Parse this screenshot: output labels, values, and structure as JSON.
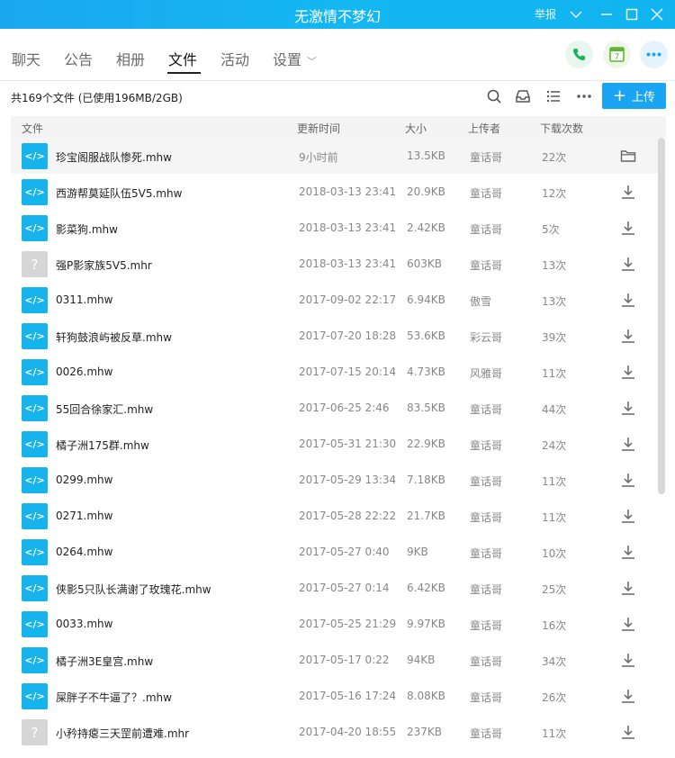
{
  "window": {
    "title": "无激情不梦幻",
    "report_label": "举报"
  },
  "tabs": [
    {
      "label": "聊天"
    },
    {
      "label": "公告"
    },
    {
      "label": "相册"
    },
    {
      "label": "文件",
      "active": true
    },
    {
      "label": "活动"
    },
    {
      "label": "设置"
    }
  ],
  "header_buttons": {
    "calendar_day": "7"
  },
  "toolbar": {
    "summary": "共169个文件 (已使用196MB/2GB)",
    "upload_label": "上传"
  },
  "columns": {
    "file": "文件",
    "updated": "更新时间",
    "size": "大小",
    "uploader": "上传者",
    "downloads": "下载次数"
  },
  "colors": {
    "accent": "#1aa5f2",
    "code_icon": "#16b3ed",
    "unknown_icon": "#d6d6d6"
  },
  "files": [
    {
      "name": "珍宝阁服战队惨死.mhw",
      "time": "9小时前",
      "size": "13.5KB",
      "uploader": "童话哥",
      "downloads": "22次",
      "icon": "code-file-icon",
      "action": "folder-icon"
    },
    {
      "name": "西游帮莫延队伍5V5.mhw",
      "time": "2018-03-13 23:41",
      "size": "20.9KB",
      "uploader": "童话哥",
      "downloads": "12次",
      "icon": "code-file-icon",
      "action": "download-icon"
    },
    {
      "name": "影菜狗.mhw",
      "time": "2018-03-13 23:41",
      "size": "2.42KB",
      "uploader": "童话哥",
      "downloads": "5次",
      "icon": "code-file-icon",
      "action": "download-icon"
    },
    {
      "name": "强P影家族5V5.mhr",
      "time": "2018-03-13 23:41",
      "size": "603KB",
      "uploader": "童话哥",
      "downloads": "13次",
      "icon": "unknown-file-icon",
      "action": "download-icon"
    },
    {
      "name": "0311.mhw",
      "time": "2017-09-02 22:17",
      "size": "6.94KB",
      "uploader": "傲雪",
      "downloads": "13次",
      "icon": "code-file-icon",
      "action": "download-icon"
    },
    {
      "name": "轩狗鼓浪屿被反草.mhw",
      "time": "2017-07-20 18:28",
      "size": "53.6KB",
      "uploader": "彩云哥",
      "downloads": "39次",
      "icon": "code-file-icon",
      "action": "download-icon"
    },
    {
      "name": "0026.mhw",
      "time": "2017-07-15 20:14",
      "size": "4.73KB",
      "uploader": "风雅哥",
      "downloads": "11次",
      "icon": "code-file-icon",
      "action": "download-icon"
    },
    {
      "name": "55回合徐家汇.mhw",
      "time": "2017-06-25 2:46",
      "size": "83.5KB",
      "uploader": "童话哥",
      "downloads": "44次",
      "icon": "code-file-icon",
      "action": "download-icon"
    },
    {
      "name": "橘子洲175群.mhw",
      "time": "2017-05-31 21:30",
      "size": "22.9KB",
      "uploader": "童话哥",
      "downloads": "24次",
      "icon": "code-file-icon",
      "action": "download-icon"
    },
    {
      "name": "0299.mhw",
      "time": "2017-05-29 13:34",
      "size": "7.18KB",
      "uploader": "童话哥",
      "downloads": "11次",
      "icon": "code-file-icon",
      "action": "download-icon"
    },
    {
      "name": "0271.mhw",
      "time": "2017-05-28 22:22",
      "size": "21.7KB",
      "uploader": "童话哥",
      "downloads": "11次",
      "icon": "code-file-icon",
      "action": "download-icon"
    },
    {
      "name": "0264.mhw",
      "time": "2017-05-27 0:40",
      "size": "9KB",
      "uploader": "童话哥",
      "downloads": "10次",
      "icon": "code-file-icon",
      "action": "download-icon"
    },
    {
      "name": "侠影5只队长满谢了玫瑰花.mhw",
      "time": "2017-05-27 0:14",
      "size": "6.42KB",
      "uploader": "童话哥",
      "downloads": "25次",
      "icon": "code-file-icon",
      "action": "download-icon"
    },
    {
      "name": "0033.mhw",
      "time": "2017-05-25 21:29",
      "size": "9.97KB",
      "uploader": "童话哥",
      "downloads": "16次",
      "icon": "code-file-icon",
      "action": "download-icon"
    },
    {
      "name": "橘子洲3E皇宫.mhw",
      "time": "2017-05-17 0:22",
      "size": "94KB",
      "uploader": "童话哥",
      "downloads": "34次",
      "icon": "code-file-icon",
      "action": "download-icon"
    },
    {
      "name": "屎胖子不牛逼了？.mhw",
      "time": "2017-05-16 17:24",
      "size": "8.08KB",
      "uploader": "童话哥",
      "downloads": "26次",
      "icon": "code-file-icon",
      "action": "download-icon"
    },
    {
      "name": "小矜持瘪三天罡前遭难.mhr",
      "time": "2017-04-20 18:55",
      "size": "237KB",
      "uploader": "童话哥",
      "downloads": "11次",
      "icon": "unknown-file-icon",
      "action": "download-icon"
    }
  ]
}
